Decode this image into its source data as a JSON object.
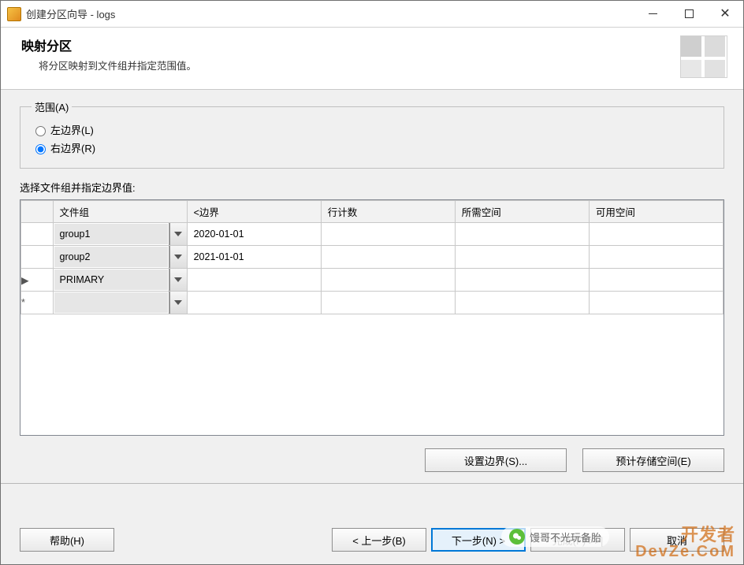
{
  "window": {
    "title": "创建分区向导 - logs"
  },
  "header": {
    "title": "映射分区",
    "subtitle": "将分区映射到文件组并指定范围值。"
  },
  "range": {
    "legend": "范围(A)",
    "left": {
      "label": "左边界(L)",
      "checked": false
    },
    "right": {
      "label": "右边界(R)",
      "checked": true
    }
  },
  "grid": {
    "label": "选择文件组并指定边界值:",
    "columns": {
      "filegroup": "文件组",
      "boundary": "<边界",
      "rowcount": "行计数",
      "required": "所需空间",
      "available": "可用空间"
    },
    "rows": [
      {
        "handle": "",
        "filegroup": "group1",
        "boundary": "2020-01-01",
        "rowcount": "",
        "required": "",
        "available": ""
      },
      {
        "handle": "",
        "filegroup": "group2",
        "boundary": "2021-01-01",
        "rowcount": "",
        "required": "",
        "available": ""
      },
      {
        "handle": "▶",
        "filegroup": "PRIMARY",
        "boundary": "",
        "rowcount": "",
        "required": "",
        "available": ""
      },
      {
        "handle": "*",
        "filegroup": "",
        "boundary": "",
        "rowcount": "",
        "required": "",
        "available": ""
      }
    ]
  },
  "side_buttons": {
    "set_boundaries": "设置边界(S)...",
    "estimate_storage": "预计存储空间(E)"
  },
  "footer": {
    "help": "帮助(H)",
    "back": "< 上一步(B)",
    "next": "下一步(N) >",
    "finish": "完成(F) >>|",
    "cancel": "取消"
  },
  "watermark": {
    "pill": "馒哥不光玩备胎",
    "line1": "开发者",
    "line2": "DevZe.CoM"
  }
}
